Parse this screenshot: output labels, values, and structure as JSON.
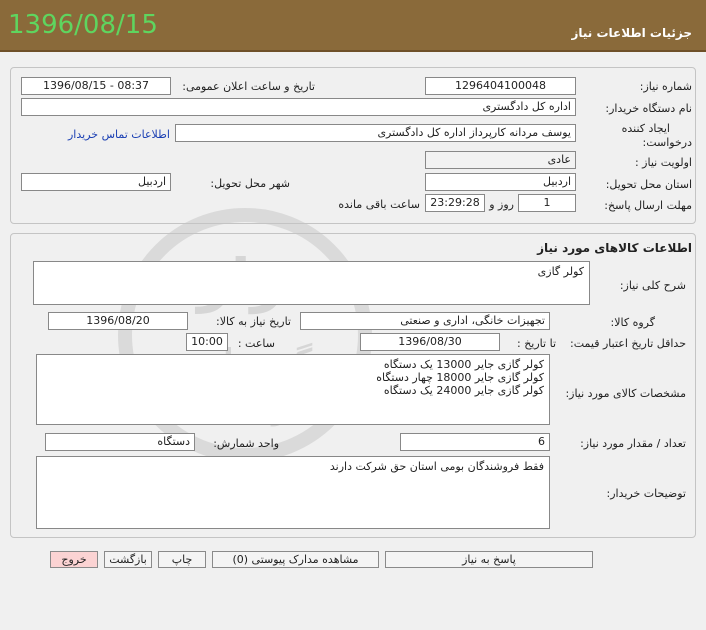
{
  "header": {
    "date": "1396/08/15",
    "title": "جزئیات اطلاعات نیاز"
  },
  "need_info": {
    "need_number_label": "شماره نیاز:",
    "need_number": "1296404100048",
    "announce_label": "تاریخ و ساعت اعلان عمومی:",
    "announce_value": "1396/08/15 - 08:37",
    "buyer_org_label": "نام دستگاه خریدار:",
    "buyer_org": "اداره کل دادگستری",
    "creator_label_line1": "ایجاد کننده",
    "creator_label_line2": "درخواست:",
    "creator": "یوسف  مردانه  کارپرداز اداره کل دادگستری",
    "contact_link": "اطلاعات تماس خریدار",
    "priority_label": "اولویت نیاز :",
    "priority": "عادی",
    "province_label": "استان محل تحویل:",
    "province": "اردبیل",
    "city_label": "شهر محل تحویل:",
    "city": "اردبیل",
    "deadline_label": "مهلت ارسال پاسخ:",
    "days": "1",
    "days_label": "روز و",
    "time_left": "23:29:28",
    "remaining_label": "ساعت باقی مانده"
  },
  "goods": {
    "section_title": "اطلاعات کالاهای مورد نیاز",
    "general_desc_label": "شرح کلی نیاز:",
    "general_desc": "کولر گازی",
    "group_label": "گروه کالا:",
    "group": "تجهیزات خانگی، اداری و صنعتی",
    "need_date_label": "تاریخ نیاز به کالا:",
    "need_date": "1396/08/20",
    "min_validity_label": "حداقل تاریخ اعتبار قیمت:",
    "to_date_label": "تا تاریخ :",
    "to_date": "1396/08/30",
    "time_label": "ساعت :",
    "time": "10:00",
    "specs_label": "مشخصات کالای مورد نیاز:",
    "specs": [
      "کولر گازی جایر  13000 یک دستگاه",
      "کولر گازی  جایر 18000 چهار دستگاه",
      "کولر گازی جایر  24000 یک دستگاه"
    ],
    "quantity_label": "تعداد / مقدار مورد نیاز:",
    "quantity": "6",
    "unit_label": "واحد شمارش:",
    "unit": "دستگاه",
    "buyer_notes_label": "توضیحات خریدار:",
    "buyer_notes": "فقط فروشندگان بومی استان حق شرکت دارند"
  },
  "buttons": {
    "reply": "پاسخ به نیاز",
    "attachments": "مشاهده مدارک پیوستی (0)",
    "print": "چاپ",
    "back": "بازگشت",
    "exit": "خروج"
  },
  "watermark": {
    "line1": "هزاره",
    "line2": "گستران",
    "line3": "ارتباط"
  }
}
